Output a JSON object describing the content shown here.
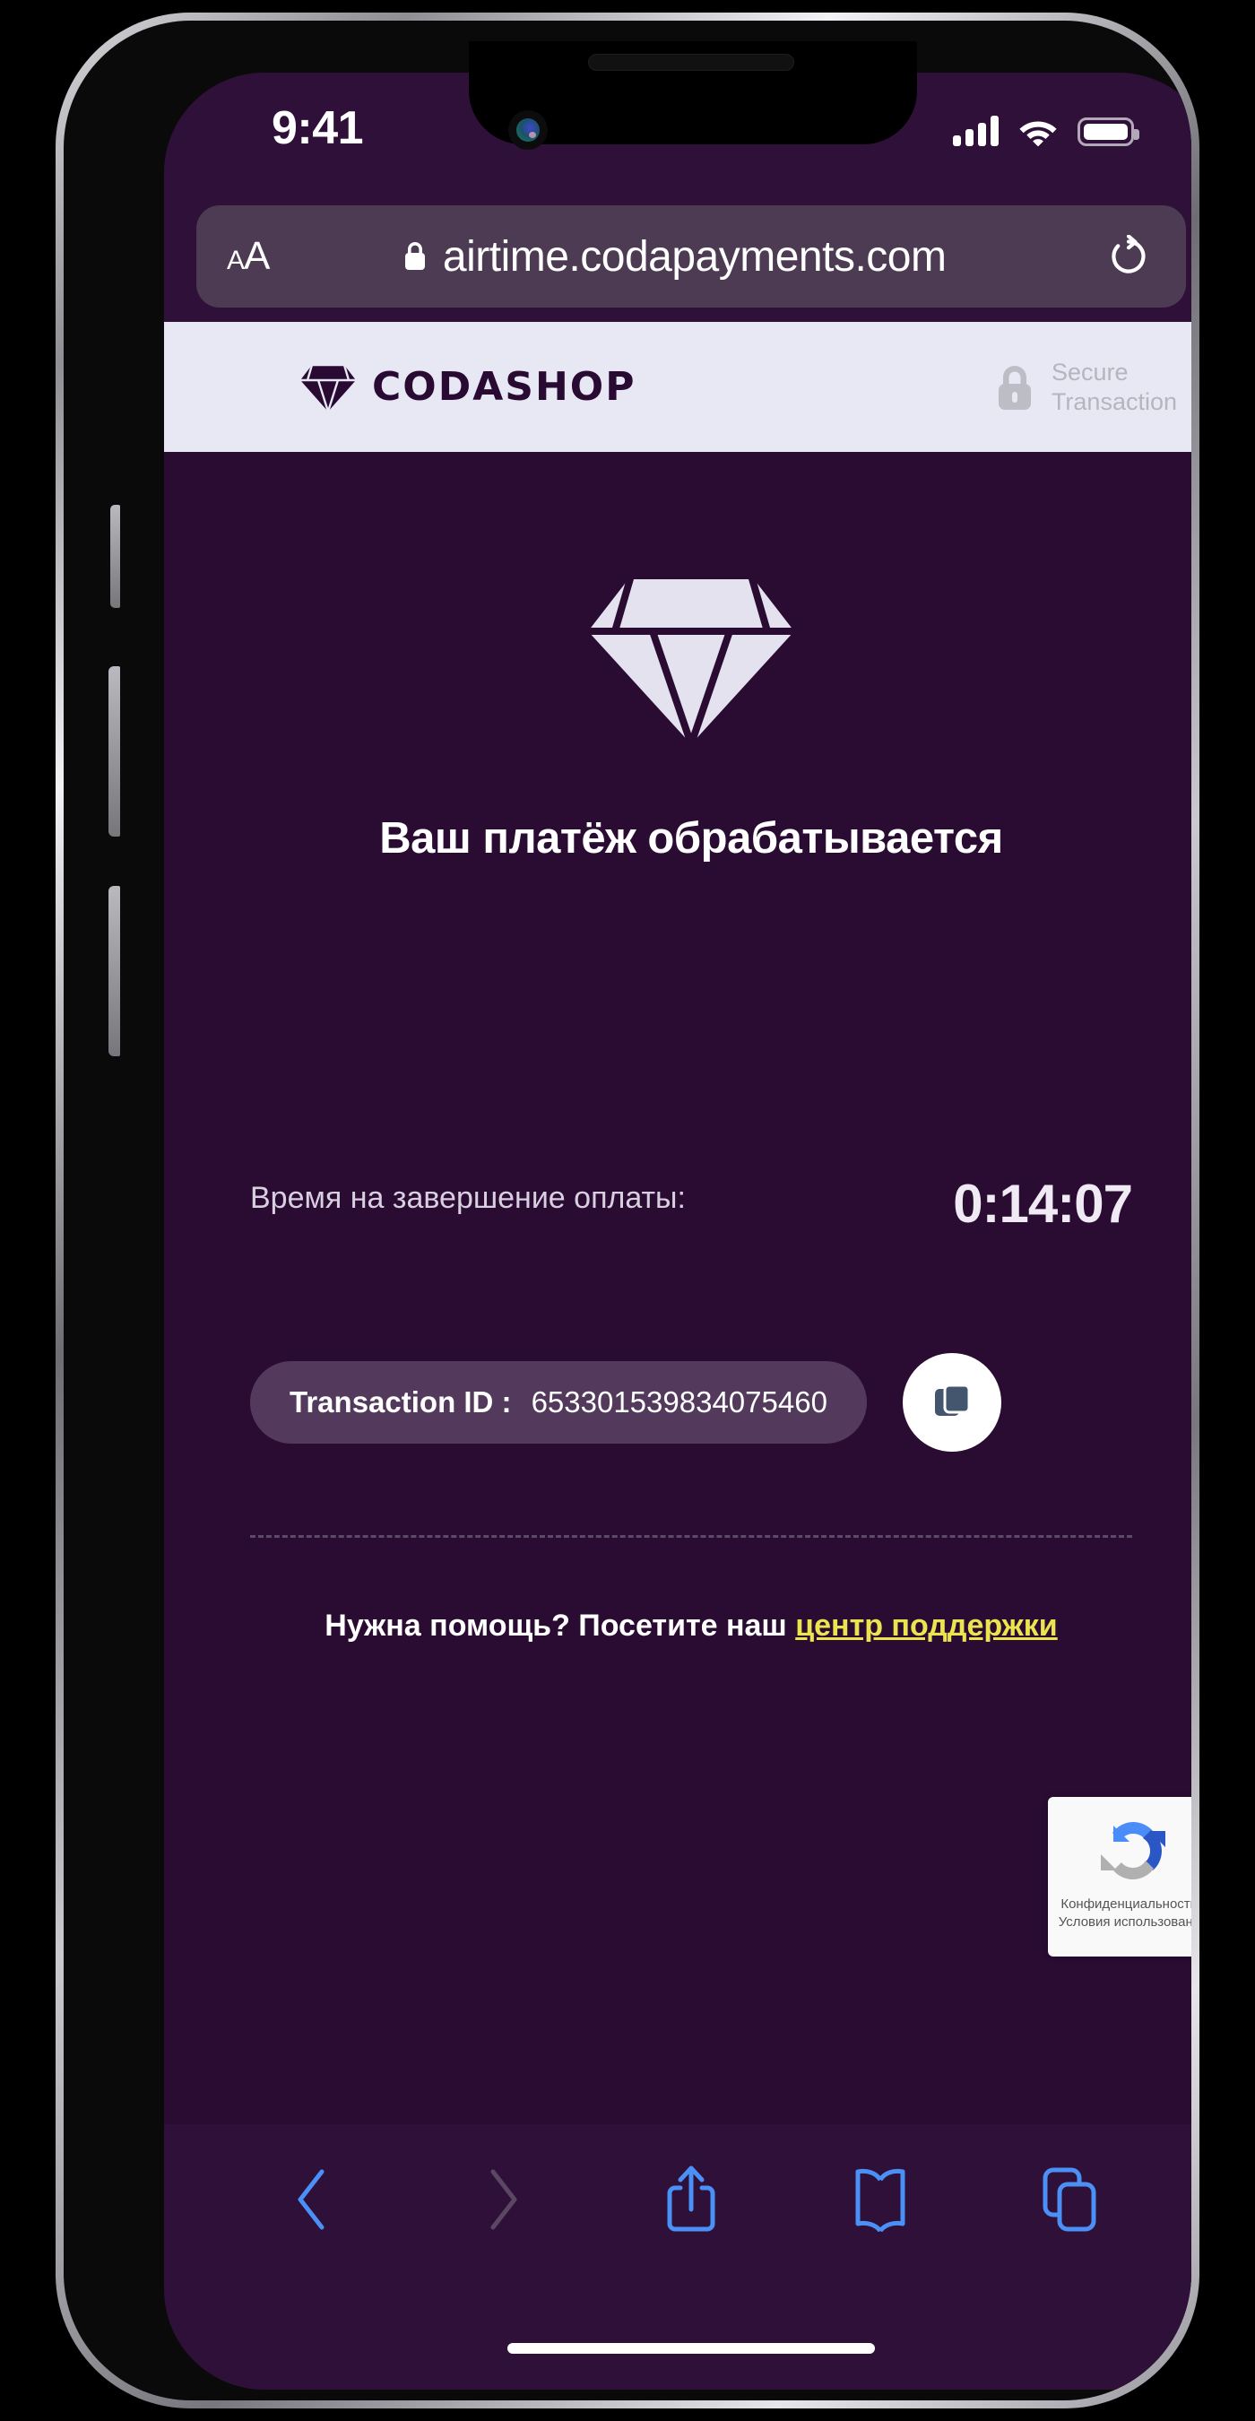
{
  "status_bar": {
    "time": "9:41",
    "signal_icon": "cellular-signal-icon",
    "wifi_icon": "wifi-icon",
    "battery_icon": "battery-full-icon"
  },
  "browser": {
    "aa_small": "A",
    "aa_big": "A",
    "lock_icon": "lock-icon",
    "url": "airtime.codapayments.com",
    "reload_icon": "reload-icon",
    "bottom_toolbar": {
      "back_label": "back-icon",
      "forward_label": "forward-icon",
      "share_label": "share-icon",
      "bookmarks_label": "bookmarks-icon",
      "tabs_label": "tabs-icon"
    }
  },
  "site_header": {
    "brand_name": "CODASHOP",
    "brand_logo_icon": "codashop-diamond-icon",
    "secure_lock_icon": "lock-icon",
    "secure_line1": "Secure",
    "secure_line2": "Transaction"
  },
  "main": {
    "hero_icon": "diamond-icon",
    "headline": "Ваш платёж обрабатывается",
    "timer_label": "Время на завершение оплаты:",
    "timer_value": "0:14:07",
    "transaction_label": "Transaction ID :",
    "transaction_value": "653301539834075460",
    "copy_icon": "copy-icon",
    "support_prefix": "Нужна помощь? Посетите наш ",
    "support_link": "центр поддержки"
  },
  "recaptcha": {
    "logo_icon": "recaptcha-icon",
    "privacy": "Конфиденциальность -",
    "terms": "Условия использования"
  },
  "colors": {
    "page_background": "#2a0c33",
    "chrome_background": "#2e1038",
    "header_background": "#e8e8f4",
    "brand_purple": "#280a33",
    "pill_background": "#533a5c",
    "link_yellow": "#ece44f",
    "toolbar_blue": "#4a90f7",
    "copy_icon_blue": "#44556e"
  }
}
